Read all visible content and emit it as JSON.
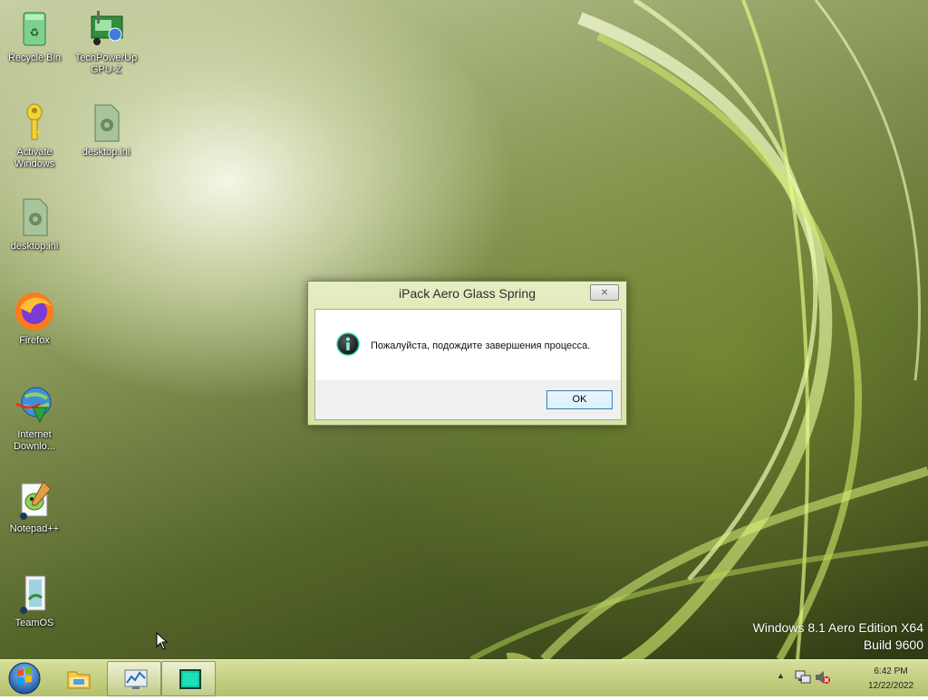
{
  "desktop": {
    "icons": [
      {
        "label": "Recycle Bin"
      },
      {
        "label": "TechPowerUp GPU-Z"
      },
      {
        "label": "Activate Windows"
      },
      {
        "label": "desktop.ini"
      },
      {
        "label": "desktop.ini"
      },
      {
        "label": "Firefox"
      },
      {
        "label": "Internet Downlo..."
      },
      {
        "label": "Notepad++"
      },
      {
        "label": "TeamOS"
      }
    ],
    "watermark": {
      "line1": "Windows 8.1 Aero Edition X64",
      "line2": "Build 9600"
    }
  },
  "dialog": {
    "title": "iPack  Aero Glass Spring",
    "close_symbol": "⨯",
    "message": "Пожалуйста, подождите завершения процесса.",
    "ok_label": "OK",
    "icon": "info-icon"
  },
  "taskbar": {
    "start_icon": "windows-start-orb",
    "pinned": [
      {
        "icon": "file-explorer-icon"
      },
      {
        "icon": "performance-monitor-icon"
      },
      {
        "icon": "ipack-window-icon"
      }
    ],
    "tray": {
      "icons": [
        "show-hidden-icons-arrow",
        "network-icon",
        "volume-muted-icon"
      ],
      "time": "6:42 PM",
      "date": "12/22/2022"
    }
  },
  "colors": {
    "accent": "#c4cf82",
    "dialog_frame": "#d8e2a8",
    "button_border": "#3c7fb1"
  }
}
